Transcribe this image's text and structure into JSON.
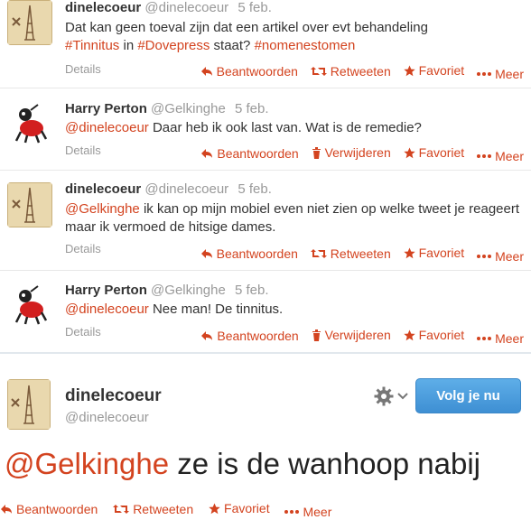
{
  "actions": {
    "reply": "Beantwoorden",
    "retweet": "Retweeten",
    "delete": "Verwijderen",
    "favorite": "Favoriet",
    "more": "Meer"
  },
  "details_label": "Details",
  "tweets": [
    {
      "fullname": "dinelecoeur",
      "username": "@dinelecoeur",
      "time": "5 feb.",
      "text_parts": [
        "Dat kan geen toeval zijn dat een artikel over evt behandeling",
        "#Tinnitus",
        " in ",
        "#Dovepress",
        " staat? ",
        "#nomenestomen"
      ]
    },
    {
      "fullname": "Harry Perton",
      "username": "@Gelkinghe",
      "time": "5 feb.",
      "text_parts": [
        "@dinelecoeur",
        " Daar heb ik ook last van. Wat is de remedie?"
      ]
    },
    {
      "fullname": "dinelecoeur",
      "username": "@dinelecoeur",
      "time": "5 feb.",
      "text_parts": [
        "@Gelkinghe",
        " ik kan op mijn mobiel even niet zien op welke tweet je reageert  maar ik vermoed de hitsige dames."
      ]
    },
    {
      "fullname": "Harry Perton",
      "username": "@Gelkinghe",
      "time": "5 feb.",
      "text_parts": [
        "@dinelecoeur",
        " Nee man! De tinnitus."
      ]
    }
  ],
  "expanded": {
    "fullname": "dinelecoeur",
    "username": "@dinelecoeur",
    "follow_label": "Volg je nu",
    "text_mention": "@Gelkinghe",
    "text_rest": " ze is de wanhoop nabij"
  },
  "colors": {
    "link": "#d3431f",
    "follow_button": "#4a9bdc"
  },
  "icons": {
    "reply": "reply-arrow-icon",
    "retweet": "retweet-icon",
    "delete": "trash-icon",
    "favorite": "star-icon",
    "more": "ellipsis-icon",
    "settings": "gear-icon"
  }
}
